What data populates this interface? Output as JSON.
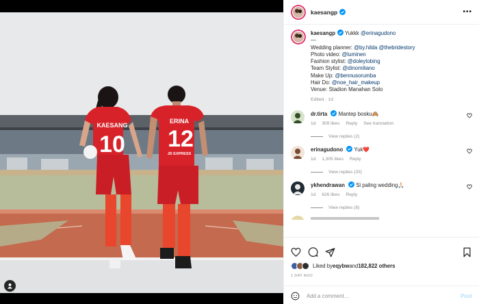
{
  "post": {
    "username": "kaesangp",
    "more": "•••"
  },
  "caption": {
    "username": "kaesangp",
    "text": "Yukkk",
    "mention": "@erinagudono",
    "separator": "—",
    "lines": [
      {
        "label": "Wedding planner: ",
        "value": "@by.hilda @thebridestory"
      },
      {
        "label": "Photo video: ",
        "value": "@luminen"
      },
      {
        "label": "Fashion stylist: ",
        "value": "@doleytobing"
      },
      {
        "label": "Team Stylist: ",
        "value": "@dinomiliano"
      },
      {
        "label": "Make Up: ",
        "value": "@bennusorumba"
      },
      {
        "label": "Hair Do: ",
        "value": "@noe_hair_makeup"
      },
      {
        "label": "Venue: ",
        "value": "Stadion Manahan Solo"
      }
    ],
    "meta": "Edited · 1d"
  },
  "comments": [
    {
      "user": "dr.tirta",
      "text": "Mantep bosku🙈",
      "time": "1d",
      "likes": "309 likes",
      "reply": "Reply",
      "extra": "See translation",
      "replies": "View replies (2)"
    },
    {
      "user": "erinagudono",
      "text": "Yuk❤️",
      "time": "1d",
      "likes": "1,305 likes",
      "reply": "Reply",
      "extra": "",
      "replies": "View replies (33)"
    },
    {
      "user": "ykhendrawan",
      "text": "Si paling wedding🙏🏻",
      "time": "1d",
      "likes": "626 likes",
      "reply": "Reply",
      "extra": "",
      "replies": "View replies (8)"
    }
  ],
  "photo": {
    "left_player_name": "KAESANG",
    "left_player_number": "10",
    "right_player_name": "ERINA",
    "right_player_number": "12",
    "sponsor": "JD EXPRESS"
  },
  "likes": {
    "prefix": "Liked by ",
    "user": "eqybw",
    "middle": " and ",
    "count": "182,822 others"
  },
  "time_ago": "1 DAY AGO",
  "add_comment": {
    "placeholder": "Add a comment…",
    "post_label": "Post"
  },
  "colors": {
    "accent": "#0095f6",
    "link": "#00376b",
    "muted": "#8e8e8e",
    "jersey_red": "#d8222a",
    "heart_red": "#ed4956"
  },
  "icons": [
    "verified-icon",
    "more-icon",
    "heart-icon",
    "comment-icon",
    "share-icon",
    "save-icon",
    "emoji-icon",
    "tag-user-icon"
  ]
}
